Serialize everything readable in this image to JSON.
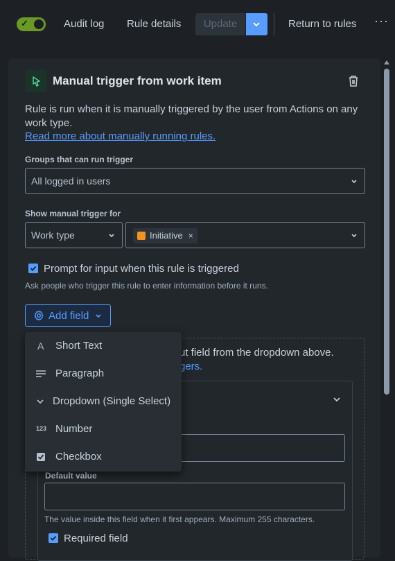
{
  "toolbar": {
    "audit_log": "Audit log",
    "rule_details": "Rule details",
    "update": "Update",
    "return": "Return to rules",
    "more": "···",
    "toggle_check": "✓"
  },
  "trigger": {
    "title": "Manual trigger from work item",
    "description": "Rule is run when it is manually triggered by the user from Actions on any work type.",
    "link": "Read more about manually running rules."
  },
  "groups": {
    "label": "Groups that can run trigger",
    "value": "All logged in users"
  },
  "show_for": {
    "label": "Show manual trigger for",
    "type_value": "Work type",
    "chip": "Initiative",
    "chip_remove": "×"
  },
  "prompt": {
    "label": "Prompt for input when this rule is triggered",
    "help": "Ask people who trigger this rule to enter information before it runs."
  },
  "add_field": {
    "label": "Add field",
    "menu": [
      {
        "icon": "A",
        "icon_name": "short-text-icon",
        "label": "Short Text"
      },
      {
        "icon": "☰",
        "icon_name": "paragraph-icon",
        "label": "Paragraph"
      },
      {
        "icon": "⌄",
        "icon_name": "dropdown-icon",
        "label": "Dropdown (Single Select)"
      },
      {
        "icon": "123",
        "icon_name": "number-icon",
        "label": "Number"
      },
      {
        "icon": "✓",
        "icon_name": "checkbox-icon",
        "label": "Checkbox"
      }
    ]
  },
  "empty_state": {
    "text": "ut field from the dropdown above.",
    "link": "gers."
  },
  "field_card": {
    "default_label": "Default value",
    "default_value": "",
    "help": "The value inside this field when it first appears. Maximum 255 characters.",
    "required": "Required field"
  },
  "colors": {
    "accent": "#579dff",
    "toggle_on": "#6a9a23",
    "background": "#1d2125",
    "panel": "#22272b",
    "chip_icon": "#f5921e"
  }
}
